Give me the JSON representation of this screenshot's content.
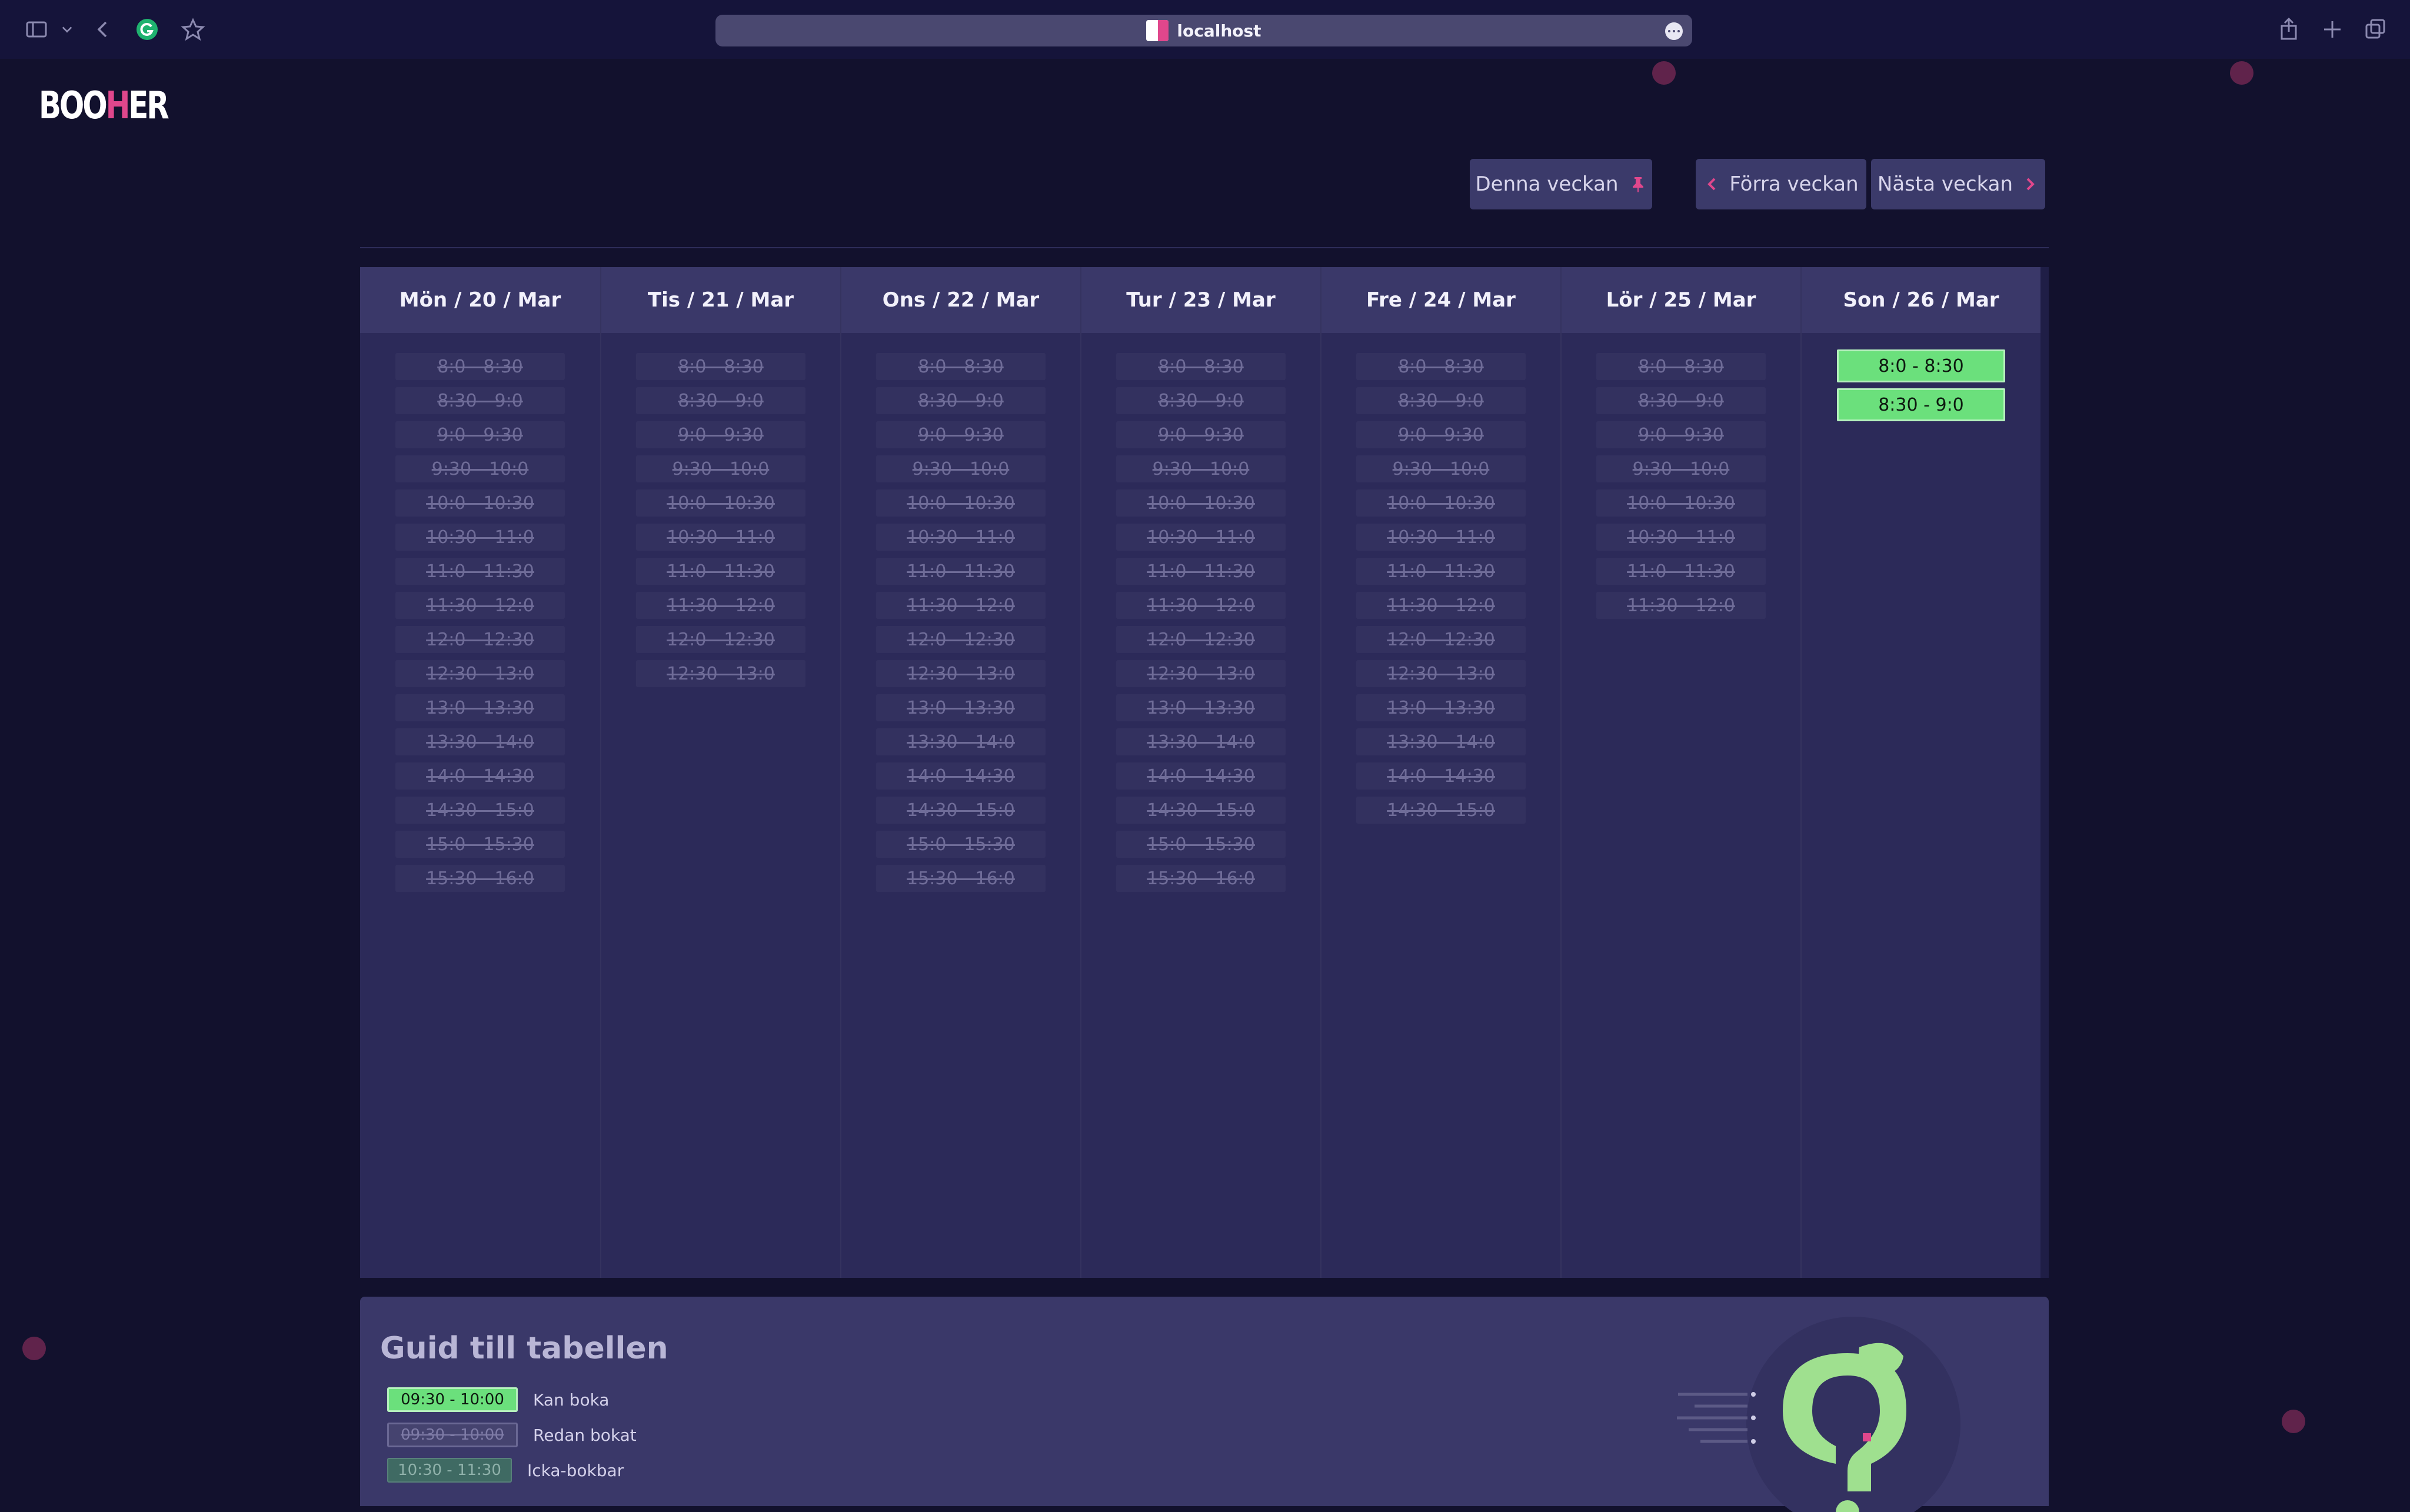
{
  "browser": {
    "url": "localhost"
  },
  "app": {
    "logo_text_a": "BOO",
    "logo_text_b": "H",
    "logo_text_c": "ER"
  },
  "week_nav": {
    "this_week": "Denna veckan",
    "prev_week": "Förra veckan",
    "next_week": "Nästa veckan"
  },
  "days": [
    {
      "label": "Mön / 20 / Mar",
      "slots": [
        "8:0 - 8:30",
        "8:30 - 9:0",
        "9:0 - 9:30",
        "9:30 - 10:0",
        "10:0 - 10:30",
        "10:30 - 11:0",
        "11:0 - 11:30",
        "11:30 - 12:0",
        "12:0 - 12:30",
        "12:30 - 13:0",
        "13:0 - 13:30",
        "13:30 - 14:0",
        "14:0 - 14:30",
        "14:30 - 15:0",
        "15:0 - 15:30",
        "15:30 - 16:0"
      ],
      "status": "booked"
    },
    {
      "label": "Tis / 21 / Mar",
      "slots": [
        "8:0 - 8:30",
        "8:30 - 9:0",
        "9:0 - 9:30",
        "9:30 - 10:0",
        "10:0 - 10:30",
        "10:30 - 11:0",
        "11:0 - 11:30",
        "11:30 - 12:0",
        "12:0 - 12:30",
        "12:30 - 13:0"
      ],
      "status": "booked"
    },
    {
      "label": "Ons / 22 / Mar",
      "slots": [
        "8:0 - 8:30",
        "8:30 - 9:0",
        "9:0 - 9:30",
        "9:30 - 10:0",
        "10:0 - 10:30",
        "10:30 - 11:0",
        "11:0 - 11:30",
        "11:30 - 12:0",
        "12:0 - 12:30",
        "12:30 - 13:0",
        "13:0 - 13:30",
        "13:30 - 14:0",
        "14:0 - 14:30",
        "14:30 - 15:0",
        "15:0 - 15:30",
        "15:30 - 16:0"
      ],
      "status": "booked"
    },
    {
      "label": "Tur / 23 / Mar",
      "slots": [
        "8:0 - 8:30",
        "8:30 - 9:0",
        "9:0 - 9:30",
        "9:30 - 10:0",
        "10:0 - 10:30",
        "10:30 - 11:0",
        "11:0 - 11:30",
        "11:30 - 12:0",
        "12:0 - 12:30",
        "12:30 - 13:0",
        "13:0 - 13:30",
        "13:30 - 14:0",
        "14:0 - 14:30",
        "14:30 - 15:0",
        "15:0 - 15:30",
        "15:30 - 16:0"
      ],
      "status": "booked"
    },
    {
      "label": "Fre / 24 / Mar",
      "slots": [
        "8:0 - 8:30",
        "8:30 - 9:0",
        "9:0 - 9:30",
        "9:30 - 10:0",
        "10:0 - 10:30",
        "10:30 - 11:0",
        "11:0 - 11:30",
        "11:30 - 12:0",
        "12:0 - 12:30",
        "12:30 - 13:0",
        "13:0 - 13:30",
        "13:30 - 14:0",
        "14:0 - 14:30",
        "14:30 - 15:0"
      ],
      "status": "booked"
    },
    {
      "label": "Lör / 25 / Mar",
      "slots": [
        "8:0 - 8:30",
        "8:30 - 9:0",
        "9:0 - 9:30",
        "9:30 - 10:0",
        "10:0 - 10:30",
        "10:30 - 11:0",
        "11:0 - 11:30",
        "11:30 - 12:0"
      ],
      "status": "booked"
    },
    {
      "label": "Son / 26 / Mar",
      "slots": [
        "8:0 - 8:30",
        "8:30 - 9:0"
      ],
      "status": "free"
    }
  ],
  "guide": {
    "title": "Guid till tabellen",
    "items": [
      {
        "chip": "09:30 - 10:00",
        "label": "Kan boka"
      },
      {
        "chip": "09:30 - 10:00",
        "label": "Redan bokat"
      },
      {
        "chip": "10:30 - 11:30",
        "label": "Icka-bokbar"
      }
    ]
  },
  "colors": {
    "background": "#12112d",
    "available": "#6be07c",
    "accent": "#e0478c"
  }
}
